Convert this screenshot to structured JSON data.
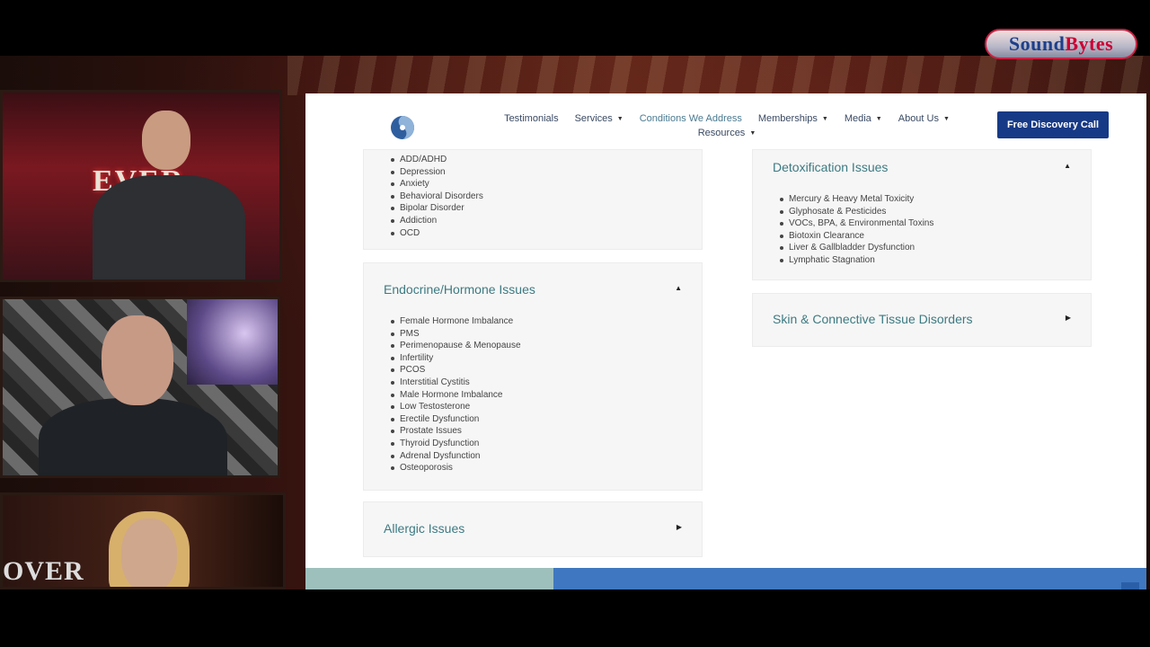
{
  "overlay": {
    "brand_logo_text_1": "Sound",
    "brand_logo_text_2": "Bytes"
  },
  "cameras": {
    "cam1_sign": "EVER",
    "cam3_sign": "OVER"
  },
  "site": {
    "nav": {
      "items": [
        {
          "label": "Testimonials",
          "dropdown": false
        },
        {
          "label": "Services",
          "dropdown": true
        },
        {
          "label": "Conditions We Address",
          "dropdown": false
        },
        {
          "label": "Memberships",
          "dropdown": true
        },
        {
          "label": "Media",
          "dropdown": true
        },
        {
          "label": "About Us",
          "dropdown": true
        },
        {
          "label": "Resources",
          "dropdown": true
        }
      ],
      "cta_label": "Free Discovery Call"
    },
    "cards": {
      "mental": {
        "items": [
          "ADD/ADHD",
          "Depression",
          "Anxiety",
          "Behavioral Disorders",
          "Bipolar Disorder",
          "Addiction",
          "OCD"
        ]
      },
      "endocrine": {
        "title": "Endocrine/Hormone Issues",
        "toggle": "▲",
        "items": [
          "Female Hormone Imbalance",
          "PMS",
          "Perimenopause & Menopause",
          "Infertility",
          "PCOS",
          "Interstitial Cystitis",
          "Male Hormone Imbalance",
          "Low Testosterone",
          "Erectile Dysfunction",
          "Prostate Issues",
          "Thyroid Dysfunction",
          "Adrenal Dysfunction",
          "Osteoporosis"
        ]
      },
      "allergic": {
        "title": "Allergic Issues",
        "toggle": "▶"
      },
      "detox": {
        "title": "Detoxification Issues",
        "toggle": "▲",
        "items": [
          "Mercury & Heavy Metal Toxicity",
          "Glyphosate & Pesticides",
          "VOCs, BPA, & Environmental Toxins",
          "Biotoxin Clearance",
          "Liver & Gallbladder Dysfunction",
          "Lymphatic Stagnation"
        ]
      },
      "skin": {
        "title": "Skin & Connective Tissue Disorders",
        "toggle": "▶"
      }
    }
  },
  "colors": {
    "accent": "#3d7a82",
    "cta": "#173a86",
    "footer_teal": "#9ec0bd",
    "footer_blue": "#3f78c0"
  }
}
